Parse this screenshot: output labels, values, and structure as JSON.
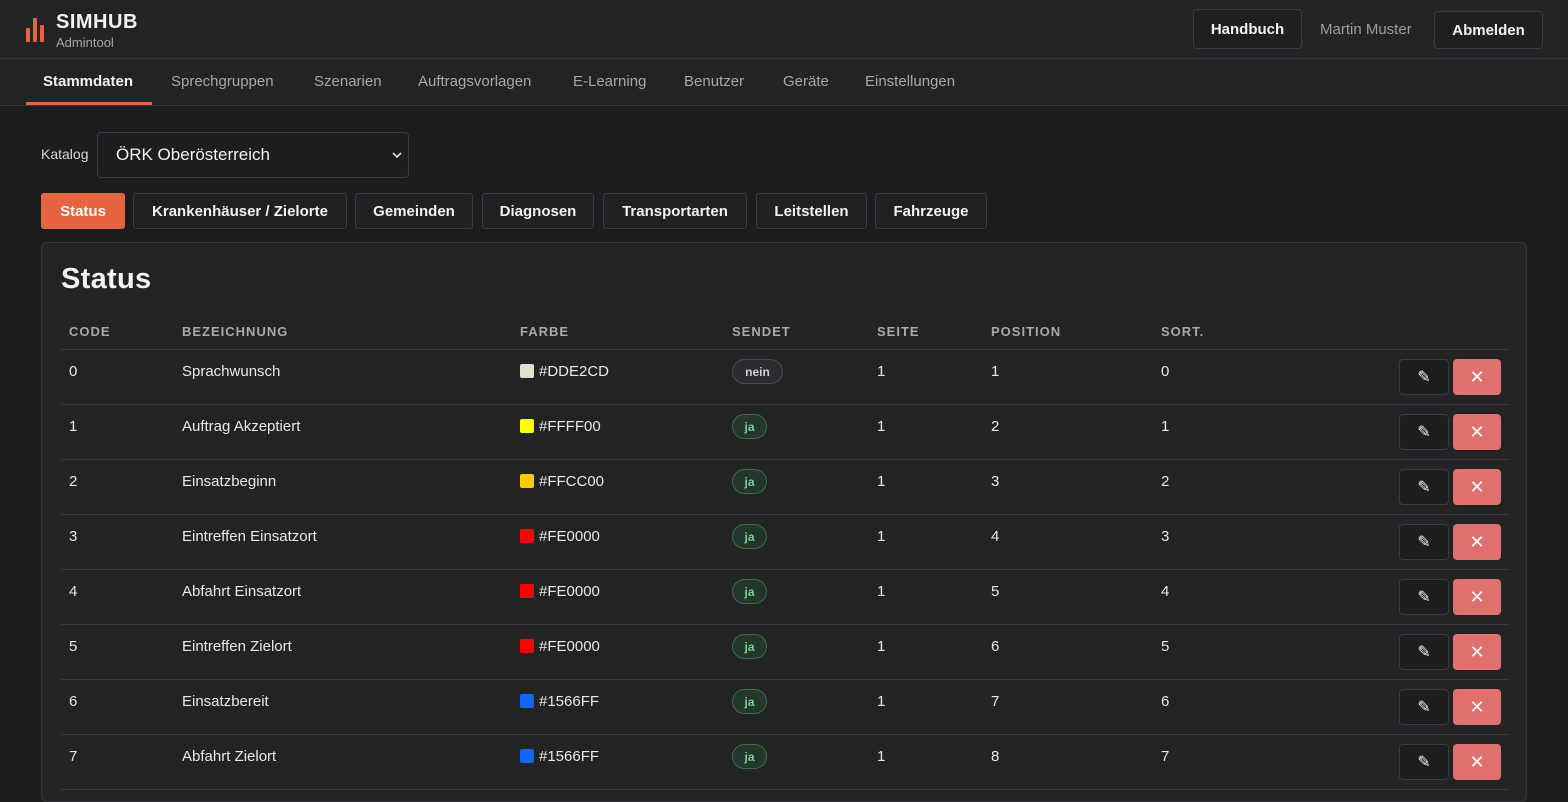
{
  "header": {
    "brand_title": "SIMHUB",
    "brand_subtitle": "Admintool",
    "manual_label": "Handbuch",
    "user_name": "Martin Muster",
    "logout_label": "Abmelden",
    "accent_color": "#e8643f"
  },
  "nav": {
    "tabs": [
      {
        "label": "Stammdaten",
        "active": true
      },
      {
        "label": "Sprechgruppen"
      },
      {
        "label": "Szenarien"
      },
      {
        "label": "Auftragsvorlagen"
      },
      {
        "label": "E-Learning"
      },
      {
        "label": "Benutzer"
      },
      {
        "label": "Geräte"
      },
      {
        "label": "Einstellungen"
      }
    ]
  },
  "catalog": {
    "label": "Katalog",
    "selected": "ÖRK Oberösterreich"
  },
  "subtabs": [
    {
      "label": "Status",
      "active": true
    },
    {
      "label": "Krankenhäuser / Zielorte"
    },
    {
      "label": "Gemeinden"
    },
    {
      "label": "Diagnosen"
    },
    {
      "label": "Transportarten"
    },
    {
      "label": "Leitstellen"
    },
    {
      "label": "Fahrzeuge"
    }
  ],
  "status_table": {
    "title": "Status",
    "columns": [
      "CODE",
      "BEZEICHNUNG",
      "FARBE",
      "SENDET",
      "SEITE",
      "POSITION",
      "SORT."
    ],
    "edit_icon": "✎",
    "delete_icon": "✕",
    "rows": [
      {
        "code": "0",
        "name": "Sprachwunsch",
        "color": "#DDE2CD",
        "sends": "nein",
        "page": "1",
        "position": "1",
        "sort": "0"
      },
      {
        "code": "1",
        "name": "Auftrag Akzeptiert",
        "color": "#FFFF00",
        "sends": "ja",
        "page": "1",
        "position": "2",
        "sort": "1"
      },
      {
        "code": "2",
        "name": "Einsatzbeginn",
        "color": "#FFCC00",
        "sends": "ja",
        "page": "1",
        "position": "3",
        "sort": "2"
      },
      {
        "code": "3",
        "name": "Eintreffen Einsatzort",
        "color": "#FE0000",
        "sends": "ja",
        "page": "1",
        "position": "4",
        "sort": "3"
      },
      {
        "code": "4",
        "name": "Abfahrt Einsatzort",
        "color": "#FE0000",
        "sends": "ja",
        "page": "1",
        "position": "5",
        "sort": "4"
      },
      {
        "code": "5",
        "name": "Eintreffen Zielort",
        "color": "#FE0000",
        "sends": "ja",
        "page": "1",
        "position": "6",
        "sort": "5"
      },
      {
        "code": "6",
        "name": "Einsatzbereit",
        "color": "#1566FF",
        "sends": "ja",
        "page": "1",
        "position": "7",
        "sort": "6"
      },
      {
        "code": "7",
        "name": "Abfahrt Zielort",
        "color": "#1566FF",
        "sends": "ja",
        "page": "1",
        "position": "8",
        "sort": "7"
      }
    ]
  }
}
